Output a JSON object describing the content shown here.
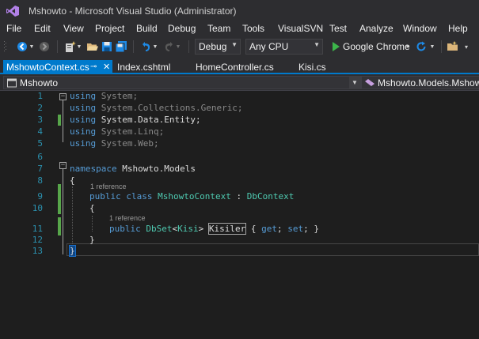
{
  "window": {
    "title": "Mshowto - Microsoft Visual Studio (Administrator)"
  },
  "menu": {
    "items": [
      "File",
      "Edit",
      "View",
      "Project",
      "Build",
      "Debug",
      "Team",
      "Tools",
      "VisualSVN",
      "Test",
      "Analyze",
      "Window",
      "Help"
    ]
  },
  "toolbar": {
    "configuration": "Debug",
    "platform": "Any CPU",
    "start_target": "Google Chrome",
    "icons": [
      "back-icon",
      "forward-icon",
      "new-project-icon",
      "open-file-icon",
      "save-icon",
      "save-all-icon",
      "undo-icon",
      "redo-icon",
      "start-icon",
      "refresh-icon",
      "folder-icon"
    ]
  },
  "tabs": [
    {
      "label": "MshowtoContext.cs",
      "active": true
    },
    {
      "label": "Index.cshtml",
      "active": false
    },
    {
      "label": "HomeController.cs",
      "active": false
    },
    {
      "label": "Kisi.cs",
      "active": false
    }
  ],
  "navbar": {
    "project": "Mshowto",
    "scope": "Mshowto.Models.MshowtoContext"
  },
  "editor": {
    "line_numbers": [
      "1",
      "2",
      "3",
      "4",
      "5",
      "6",
      "7",
      "8",
      "9",
      "10",
      "11",
      "12",
      "13"
    ],
    "code": {
      "l1_kw": "using",
      "l1_rest": " System;",
      "l2_kw": "using",
      "l2_rest": " System.Collections.Generic;",
      "l3_kw": "using",
      "l3_rest": " System.Data.Entity;",
      "l4_kw": "using",
      "l4_rest": " System.Linq;",
      "l5_kw": "using",
      "l5_rest": " System.Web;",
      "l7_kw": "namespace",
      "l7_rest": " Mshowto.Models",
      "l8": "{",
      "ref_class": "1 reference",
      "l9_kw1": "public",
      "l9_kw2": "class",
      "l9_type": "MshowtoContext",
      "l9_colon": " : ",
      "l9_base": "DbContext",
      "l10": "{",
      "ref_prop": "1 reference",
      "l11_kw": "public",
      "l11_type1": "DbSet",
      "l11_lt": "<",
      "l11_type2": "Kisi",
      "l11_gt": "> ",
      "l11_name": "Kisiler",
      "l11_open": " { ",
      "l11_get": "get",
      "l11_semi1": "; ",
      "l11_set": "set",
      "l11_close": "; }",
      "l12": "}",
      "l13": "}"
    }
  },
  "colors": {
    "accent": "#007acc",
    "keyword": "#569cd6",
    "type": "#4ec9b0",
    "line_number": "#2b91af",
    "change_marker": "#57a64a"
  }
}
